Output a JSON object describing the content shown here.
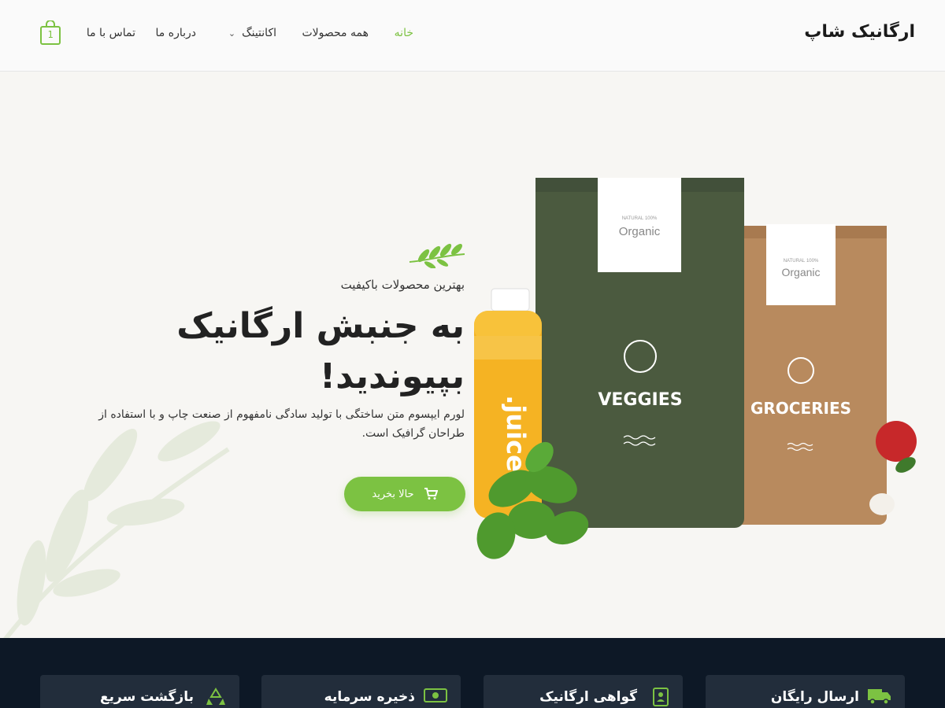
{
  "header": {
    "logo": "ارگانیک شاپ",
    "nav": [
      {
        "label": "خانه",
        "active": true
      },
      {
        "label": "همه محصولات"
      },
      {
        "label": "اکانتینگ",
        "has_dropdown": true
      },
      {
        "label": "درباره ما"
      },
      {
        "label": "تماس با ما"
      }
    ],
    "cart_count": "1"
  },
  "hero": {
    "kicker": "بهترین محصولات باکیفیت",
    "headline": "به جنبش ارگانیک بپیوندید!",
    "lead": "لورم ایپسوم متن ساختگی با تولید سادگی نامفهوم از صنعت چاپ و با استفاده از طراحان گرافیک است.",
    "cta": "حالا بخرید",
    "product_labels": {
      "bottle": "juice.",
      "bag_green_brand": "Organic",
      "bag_green_tag": "100% NATURAL",
      "bag_green_name": "VEGGIES",
      "bag_brown_brand": "Organic",
      "bag_brown_tag": "100% NATURAL",
      "bag_brown_name": "GROCERIES"
    }
  },
  "features": [
    {
      "title": "ارسال رایگان",
      "icon": "truck-icon"
    },
    {
      "title": "گواهی ارگانیک",
      "icon": "certificate-icon"
    },
    {
      "title": "ذخیره سرمایه",
      "icon": "money-icon"
    },
    {
      "title": "بازگشت سریع",
      "icon": "recycle-icon"
    }
  ],
  "colors": {
    "accent": "#7cc242",
    "footer_bg": "#0d1826",
    "card_bg": "#222d3b",
    "bag_green": "#4b5a3f",
    "bag_brown": "#b88a5e"
  }
}
